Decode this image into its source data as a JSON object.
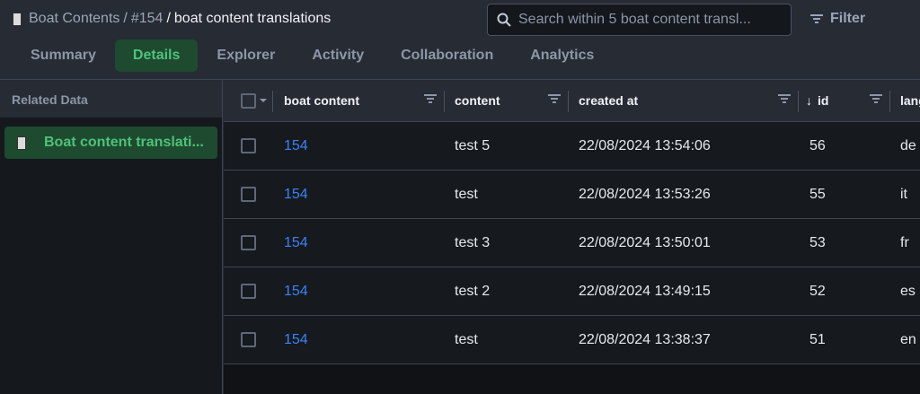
{
  "breadcrumb": {
    "root": "Boat Contents",
    "sep1": "/",
    "record": "#154",
    "sep2": "/",
    "current": "boat content translations"
  },
  "search": {
    "placeholder": "Search within 5 boat content transl..."
  },
  "filter_label": "Filter",
  "tabs": [
    "Summary",
    "Details",
    "Explorer",
    "Activity",
    "Collaboration",
    "Analytics"
  ],
  "active_tab": "Details",
  "sidebar": {
    "title": "Related Data",
    "items": [
      {
        "label": "Boat content translati..."
      }
    ]
  },
  "table": {
    "columns": [
      "boat content",
      "content",
      "created at",
      "id",
      "lang"
    ],
    "sort": {
      "column": "id",
      "direction": "desc",
      "icon": "arrow-down"
    },
    "rows": [
      {
        "boat_content": "154",
        "content": "test 5",
        "created_at": "22/08/2024 13:54:06",
        "id": "56",
        "lang": "de"
      },
      {
        "boat_content": "154",
        "content": "test",
        "created_at": "22/08/2024 13:53:26",
        "id": "55",
        "lang": "it"
      },
      {
        "boat_content": "154",
        "content": "test 3",
        "created_at": "22/08/2024 13:50:01",
        "id": "53",
        "lang": "fr"
      },
      {
        "boat_content": "154",
        "content": "test 2",
        "created_at": "22/08/2024 13:49:15",
        "id": "52",
        "lang": "es"
      },
      {
        "boat_content": "154",
        "content": "test",
        "created_at": "22/08/2024 13:38:37",
        "id": "51",
        "lang": "en"
      }
    ]
  }
}
